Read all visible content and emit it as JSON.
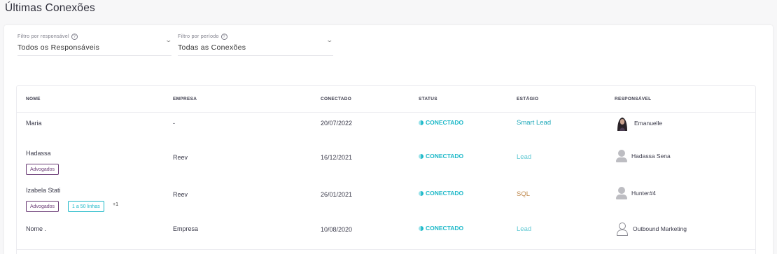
{
  "page": {
    "title": "Últimas Conexões"
  },
  "filters": {
    "responsible": {
      "label": "Filtro por responsável",
      "value": "Todos os Responsáveis"
    },
    "period": {
      "label": "Filtro por período",
      "value": "Todas as Conexões"
    }
  },
  "table": {
    "headers": [
      "NOME",
      "EMPRESA",
      "CONECTADO",
      "STATUS",
      "ESTÁGIO",
      "RESPONSÁVEL"
    ],
    "rows": [
      {
        "name": "Maria",
        "company": "-",
        "connected": "20/07/2022",
        "status": "CONECTADO",
        "stage": "Smart Lead",
        "stage_color": "#1ba7b8",
        "responsible": "Emanuelle",
        "avatar": "photo",
        "tags": []
      },
      {
        "name": "Hadassa",
        "company": "Reev",
        "connected": "16/12/2021",
        "status": "CONECTADO",
        "stage": "Lead",
        "stage_color": "#5fc8d3",
        "responsible": "Hadassa Sena",
        "avatar": "gray-person-icon",
        "tags": [
          "Advogados"
        ]
      },
      {
        "name": "Izabela Stati",
        "company": "Reev",
        "connected": "26/01/2021",
        "status": "CONECTADO",
        "stage": "SQL",
        "stage_color": "#c08a4e",
        "responsible": "Hunter#4",
        "avatar": "gray-person-icon",
        "tags": [
          "Advogados",
          "1 a 50 linhas"
        ],
        "more": "+1"
      },
      {
        "name": "Nome .",
        "company": "Empresa",
        "connected": "10/08/2020",
        "status": "CONECTADO",
        "stage": "Lead",
        "stage_color": "#5fc8d3",
        "responsible": "Outbound Marketing",
        "avatar": "outline-person-icon",
        "tags": []
      }
    ]
  },
  "colors": {
    "accent": "#1cb8c8",
    "tag_purple": "#6a3a75"
  }
}
